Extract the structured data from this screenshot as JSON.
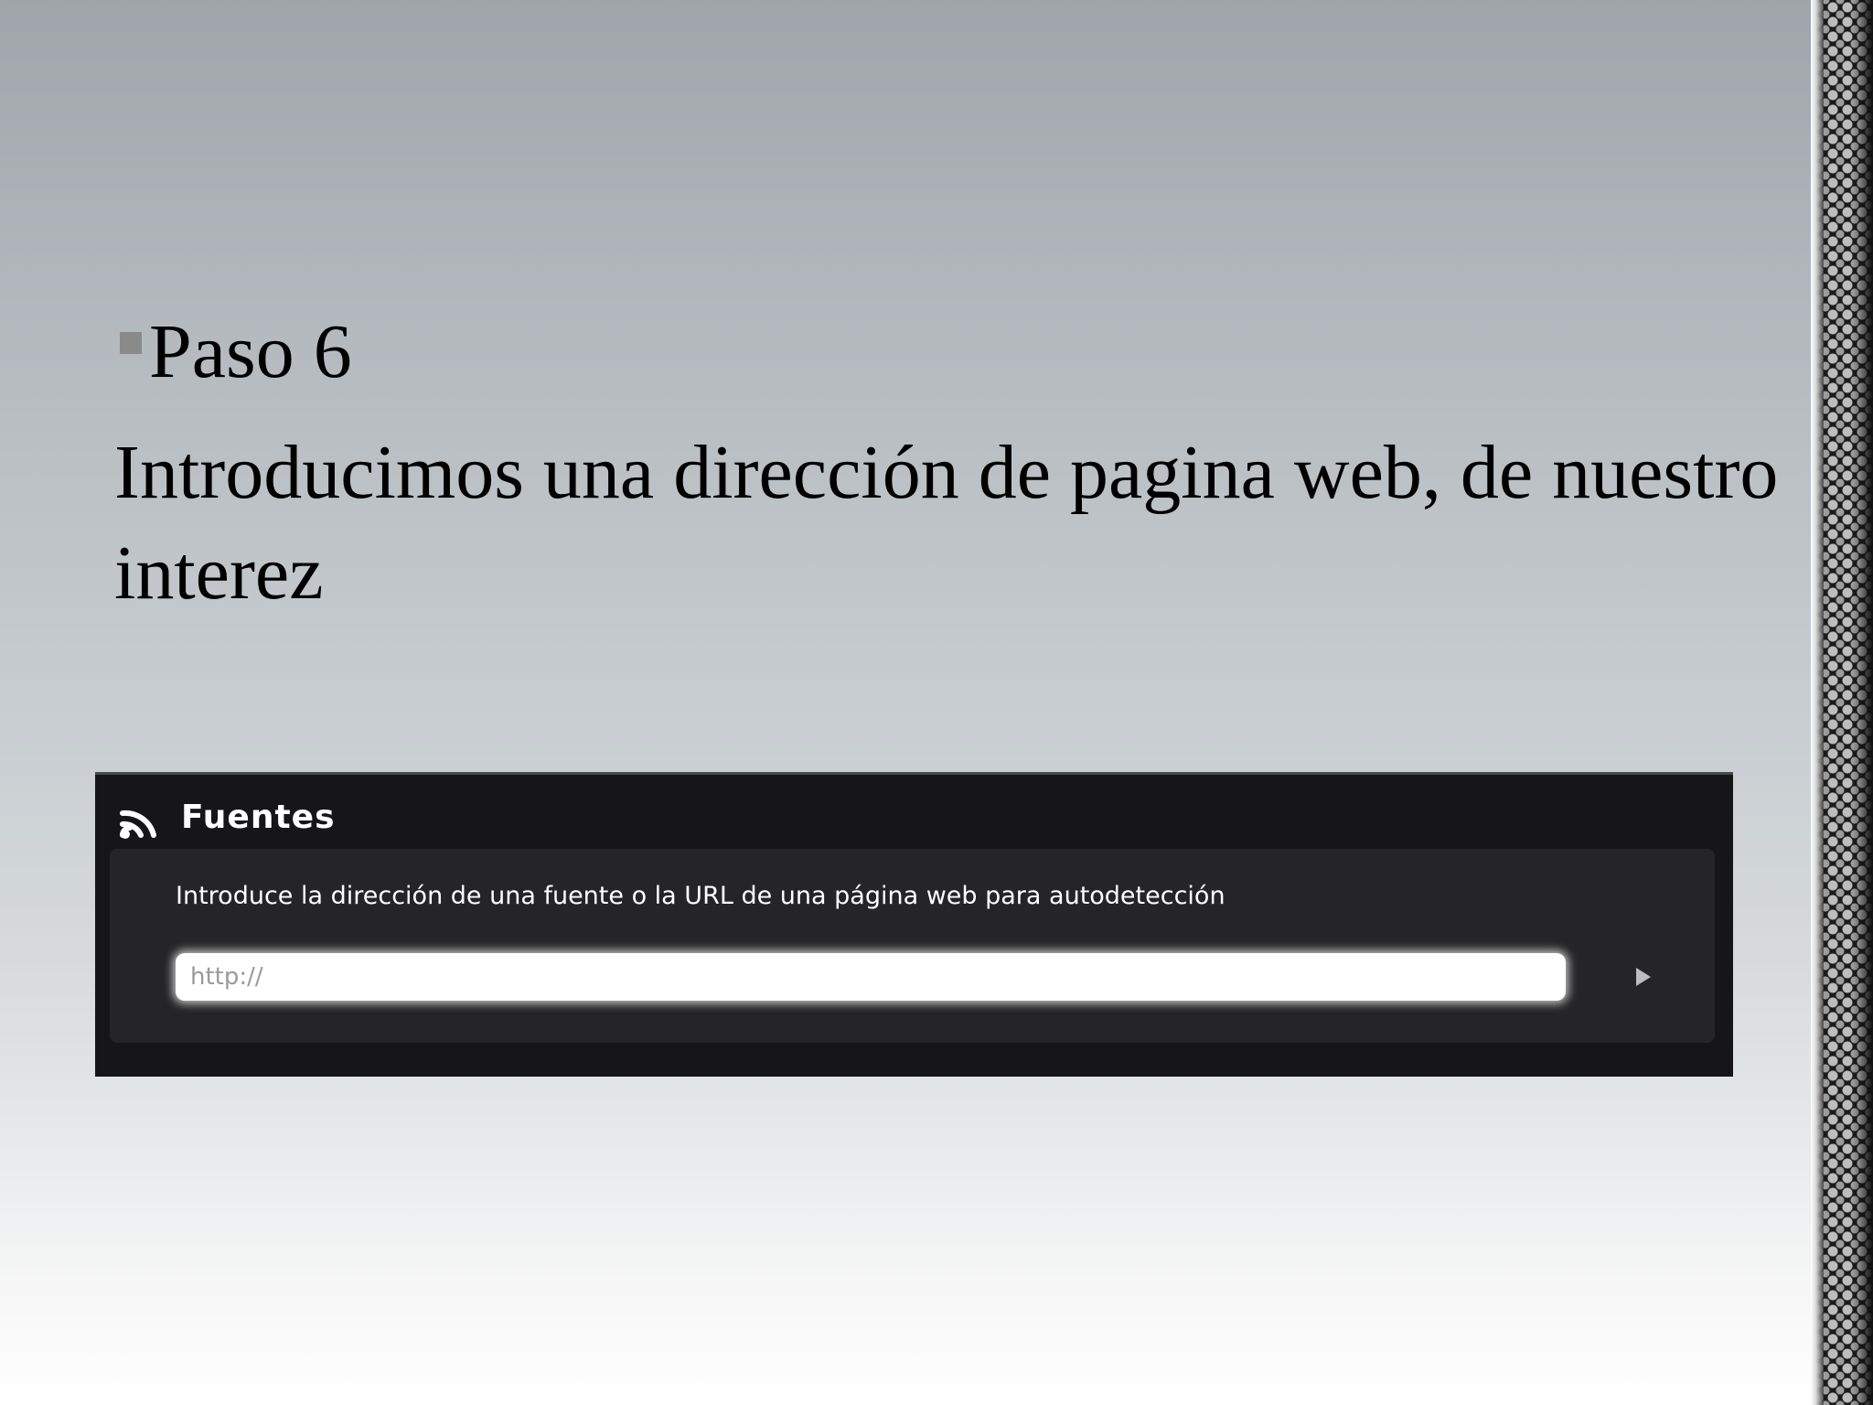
{
  "slide": {
    "bullet_heading": "Paso 6",
    "body_text": "Introducimos una dirección de pagina web, de nuestro  interez"
  },
  "panel": {
    "icon": "rss-feed-icon",
    "title": "Fuentes",
    "instructions": "Introduce la dirección de una fuente o la URL de una página web para autodetección",
    "url_input": {
      "value": "",
      "placeholder": "http://"
    },
    "submit_icon": "play-arrow-icon"
  },
  "colors": {
    "panel_background": "#161618",
    "panel_body": "#252527",
    "panel_text": "#ffffff",
    "bullet": "#8a8a8a"
  }
}
